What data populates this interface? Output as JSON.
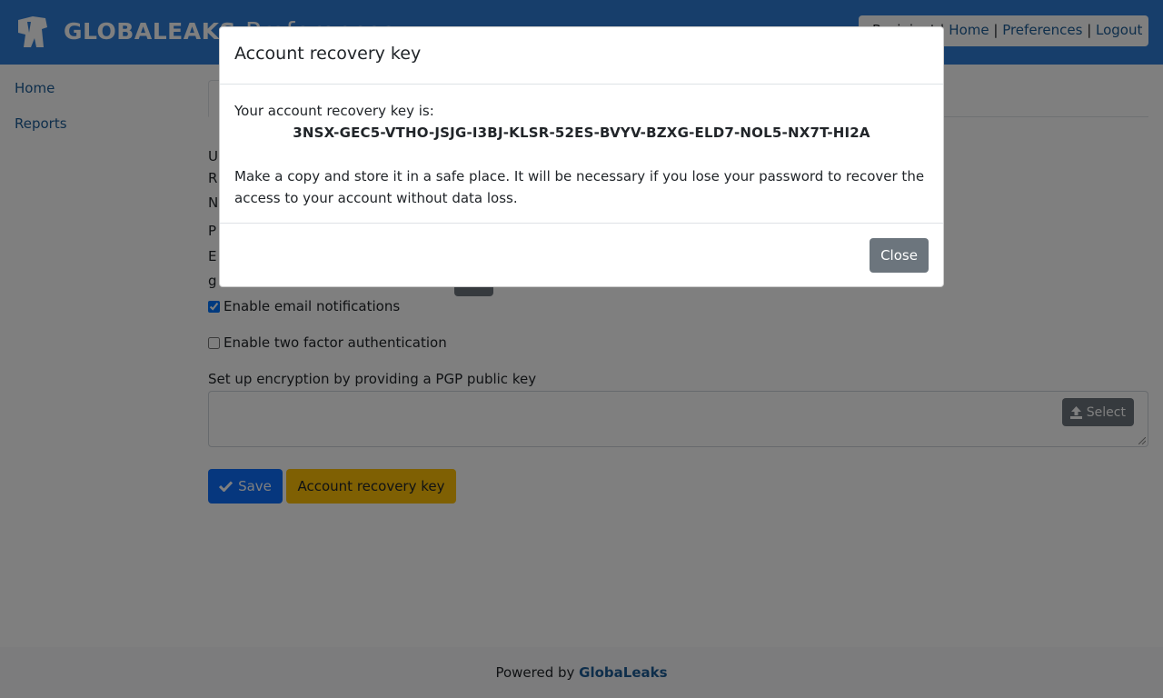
{
  "header": {
    "brand": "GLOBALEAKS",
    "page_heading": "Preferences",
    "nav": {
      "role": "Recipient",
      "home": "Home",
      "preferences": "Preferences",
      "logout": "Logout"
    }
  },
  "sidebar": {
    "items": [
      {
        "label": "Home"
      },
      {
        "label": "Reports"
      }
    ]
  },
  "form": {
    "lines": [
      "U",
      "R",
      "N",
      "P",
      "E",
      "g"
    ],
    "email_notifications_label": "Enable email notifications",
    "email_notifications_checked": true,
    "two_factor_label": "Enable two factor authentication",
    "two_factor_checked": false,
    "pgp_label": "Set up encryption by providing a PGP public key",
    "select_label": "Select",
    "save_label": "Save",
    "recovery_label": "Account recovery key"
  },
  "footer": {
    "prefix": "Powered by",
    "link": "GlobaLeaks"
  },
  "modal": {
    "title": "Account recovery key",
    "intro": "Your account recovery key is:",
    "key": "3NSX-GEC5-VTHO-JSJG-I3BJ-KLSR-52ES-BVYV-BZXG-ELD7-NOL5-NX7T-HI2A",
    "note": "Make a copy and store it in a safe place. It will be necessary if you lose your password to recover the access to your account without data loss.",
    "close_label": "Close"
  },
  "colors": {
    "header": "#2f7dd6",
    "primary": "#0d6efd",
    "warning": "#ffc107",
    "secondary": "#6c757d",
    "link": "#1c5c97"
  },
  "icons": [
    "globaleaks-logo-icon",
    "check-icon",
    "upload-icon"
  ]
}
